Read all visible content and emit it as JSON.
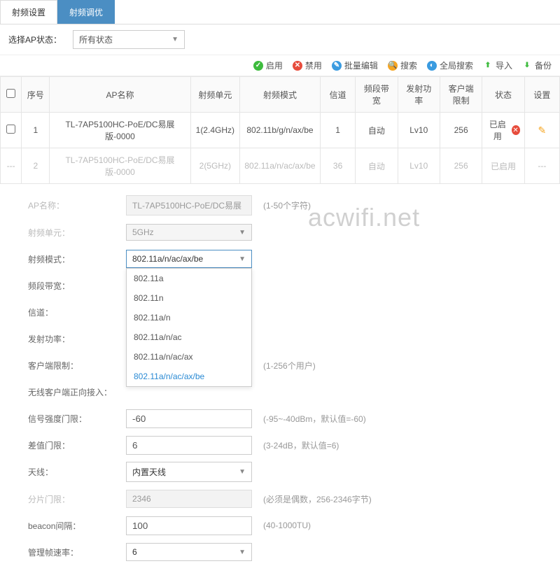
{
  "tabs": {
    "rf_settings": "射频设置",
    "rf_tuning": "射频调优"
  },
  "filter": {
    "label": "选择AP状态：",
    "value": "所有状态"
  },
  "toolbar": {
    "enable": "启用",
    "disable": "禁用",
    "batch": "批量编辑",
    "search": "搜索",
    "global": "全局搜索",
    "import": "导入",
    "backup": "备份"
  },
  "table": {
    "headers": {
      "seq": "序号",
      "ap_name": "AP名称",
      "rf_unit": "射频单元",
      "rf_mode": "射频模式",
      "channel": "信道",
      "bandwidth": "频段带宽",
      "tx_power": "发射功率",
      "client_limit": "客户端限制",
      "status": "状态",
      "settings": "设置"
    },
    "rows": [
      {
        "seq": "1",
        "ap_name": "TL-7AP5100HC-PoE/DC易展版-0000",
        "rf_unit": "1(2.4GHz)",
        "rf_mode": "802.11b/g/n/ax/be",
        "channel": "1",
        "bandwidth": "自动",
        "tx_power": "Lv10",
        "client_limit": "256",
        "status": "已启用",
        "active": true
      },
      {
        "seq": "2",
        "ap_name": "TL-7AP5100HC-PoE/DC易展版-0000",
        "rf_unit": "2(5GHz)",
        "rf_mode": "802.11a/n/ac/ax/be",
        "channel": "36",
        "bandwidth": "自动",
        "tx_power": "Lv10",
        "client_limit": "256",
        "status": "已启用",
        "active": false
      }
    ]
  },
  "form": {
    "ap_name": {
      "label": "AP名称：",
      "value": "TL-7AP5100HC-PoE/DC易展",
      "hint": "(1-50个字符)"
    },
    "rf_unit": {
      "label": "射频单元：",
      "value": "5GHz"
    },
    "rf_mode": {
      "label": "射频模式：",
      "value": "802.11a/n/ac/ax/be",
      "options": [
        "802.11a",
        "802.11n",
        "802.11a/n",
        "802.11a/n/ac",
        "802.11a/n/ac/ax",
        "802.11a/n/ac/ax/be"
      ]
    },
    "bandwidth": {
      "label": "频段带宽："
    },
    "channel": {
      "label": "信道："
    },
    "tx_power": {
      "label": "发射功率："
    },
    "client_limit": {
      "label": "客户端限制：",
      "hint": "(1-256个用户)"
    },
    "wlan_redirect": {
      "label": "无线客户端正向接入："
    },
    "rssi_threshold": {
      "label": "信号强度门限：",
      "value": "-60",
      "hint": "(-95~-40dBm，默认值=-60)"
    },
    "diff_threshold": {
      "label": "差值门限：",
      "value": "6",
      "hint": "(3-24dB，默认值=6)"
    },
    "antenna": {
      "label": "天线：",
      "value": "内置天线"
    },
    "frag_threshold": {
      "label": "分片门限：",
      "value": "2346",
      "hint": "(必须是偶数，256-2346字节)"
    },
    "beacon": {
      "label": "beacon间隔：",
      "value": "100",
      "hint": "(40-1000TU)"
    },
    "mgmt_rate": {
      "label": "管理帧速率：",
      "value": "6"
    }
  },
  "watermark": "acwifi.net",
  "dashes": "---"
}
